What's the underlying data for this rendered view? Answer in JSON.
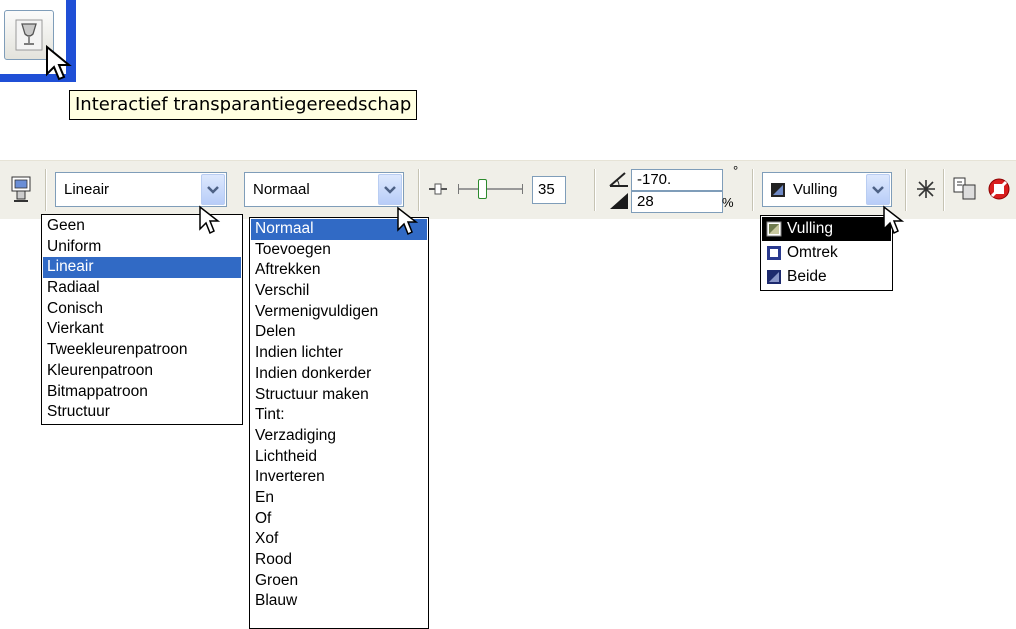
{
  "tooltip": {
    "text": "Interactief transparantiegereedschap"
  },
  "toolbar": {
    "type_combo": {
      "value": "Lineair"
    },
    "mode_combo": {
      "value": "Normaal"
    },
    "slider_value": "35",
    "angle_value": "-170.",
    "edge_pad_value": "28",
    "degree_symbol": "°",
    "percent_symbol": "%",
    "target_combo": {
      "value": "Vulling"
    }
  },
  "type_dropdown": {
    "items": [
      "Geen",
      "Uniform",
      "Lineair",
      "Radiaal",
      "Conisch",
      "Vierkant",
      "Tweekleurenpatroon",
      "Kleurenpatroon",
      "Bitmappatroon",
      "Structuur"
    ],
    "selected": "Lineair"
  },
  "mode_dropdown": {
    "items": [
      "Normaal",
      "Toevoegen",
      "Aftrekken",
      "Verschil",
      "Vermenigvuldigen",
      "Delen",
      "Indien lichter",
      "Indien donkerder",
      "Structuur maken",
      "Tint:",
      "Verzadiging",
      "Lichtheid",
      "Inverteren",
      "En",
      "Of",
      "Xof",
      "Rood",
      "Groen",
      "Blauw"
    ],
    "selected": "Normaal"
  },
  "target_dropdown": {
    "items": [
      "Vulling",
      "Omtrek",
      "Beide"
    ],
    "selected": "Vulling"
  },
  "colors": {
    "selection_blue": "#316ac5",
    "tooltip_bg": "#ffffe1",
    "toolbar_bg": "#f0efe8",
    "accent_blue": "#1f4fd6"
  }
}
